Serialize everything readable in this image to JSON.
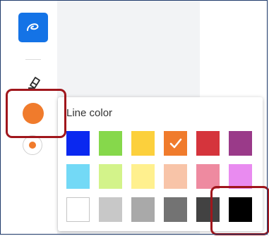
{
  "toolbar": {
    "tools": [
      {
        "name": "pen",
        "icon": "pen-loop-icon",
        "active": true
      },
      {
        "name": "eraser",
        "icon": "eraser-icon"
      },
      {
        "name": "line-color",
        "icon": "color-dot-icon",
        "color": "#f07b2c"
      },
      {
        "name": "line-size",
        "icon": "size-dot-icon",
        "color": "#f07b2c"
      }
    ],
    "accent_color": "#1473e6"
  },
  "line_color_popup": {
    "title": "Line color",
    "selected_color": "#f07b2c",
    "colors": [
      "#0a28f0",
      "#86d84b",
      "#fcd03c",
      "#f07b2c",
      "#d5343c",
      "#9a3a89",
      "#73d9f6",
      "#d3f38a",
      "#fff08e",
      "#f8c4a8",
      "#ee8aa0",
      "#e98bf0",
      "#ffffff",
      "#c8c8c8",
      "#a9a9a9",
      "#737373",
      "#424242",
      "#000000"
    ]
  },
  "annotations": {
    "highlight_color": "#a0161c"
  }
}
